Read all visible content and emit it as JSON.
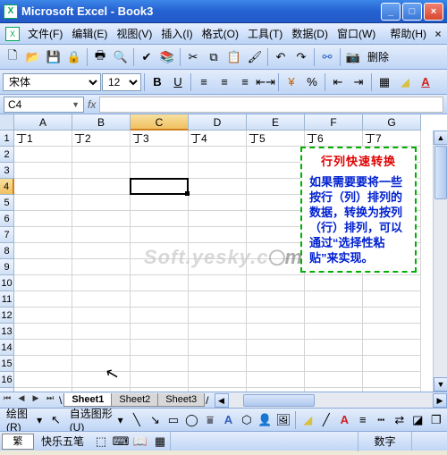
{
  "titlebar": {
    "text": "Microsoft Excel - Book3"
  },
  "menu": [
    "文件(F)",
    "编辑(E)",
    "视图(V)",
    "插入(I)",
    "格式(O)",
    "工具(T)",
    "数据(D)",
    "窗口(W)",
    "帮助(H)"
  ],
  "toolbar2": {
    "font": "宋体",
    "size": "12",
    "delete_label": "删除"
  },
  "namebox": "C4",
  "columns": [
    "A",
    "B",
    "C",
    "D",
    "E",
    "F",
    "G"
  ],
  "active_col_index": 2,
  "grid_rows": 18,
  "active_row": 4,
  "row1": [
    "丁1",
    "丁2",
    "丁3",
    "丁4",
    "丁5",
    "丁6",
    "丁7"
  ],
  "textbox": {
    "title": "行列快速转换",
    "body": "如果需要要将一些按行（列）排列的数据，转换为按列（行）排列，可以通过“选择性粘贴”来实现。"
  },
  "watermark": "Soft.yesky.c",
  "watermark_suffix": "m",
  "sheets": {
    "tabs": [
      "Sheet1",
      "Sheet2",
      "Sheet3"
    ],
    "active": 0
  },
  "draw": {
    "label": "绘图(R)",
    "autoshape": "自选图形(U)"
  },
  "status": {
    "ime": "快乐五笔",
    "num": "数字"
  }
}
